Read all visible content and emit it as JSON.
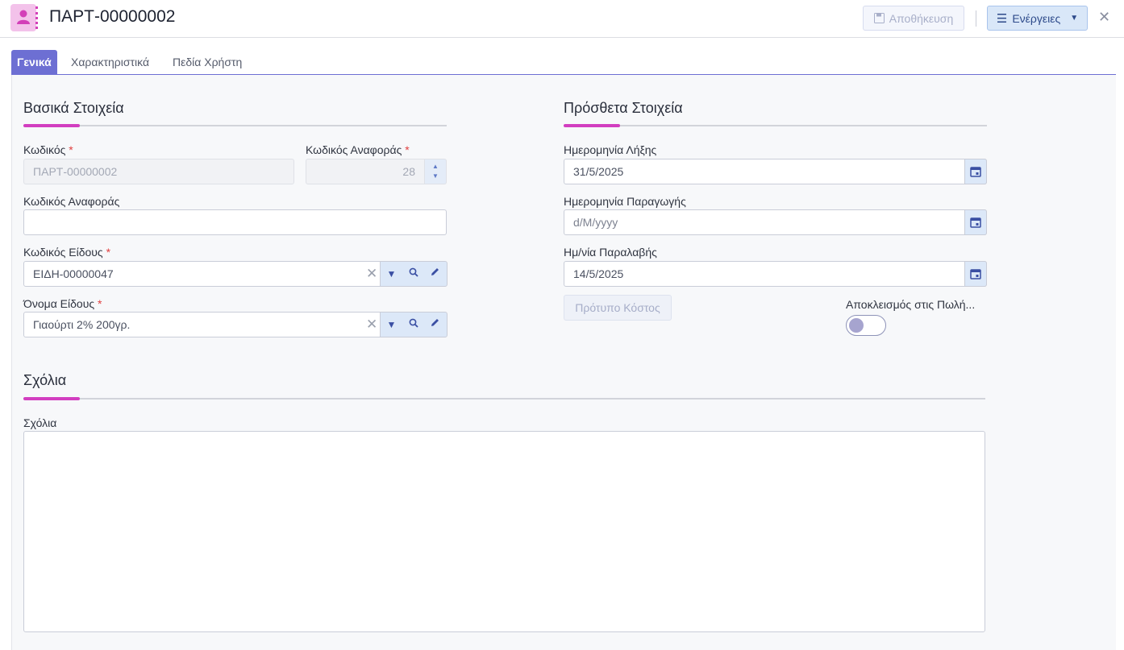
{
  "header": {
    "title": "ΠΑΡΤ-00000002",
    "save_label": "Αποθήκευση",
    "actions_label": "Ενέργειες"
  },
  "tabs": [
    {
      "label": "Γενικά",
      "active": true
    },
    {
      "label": "Χαρακτηριστικά",
      "active": false
    },
    {
      "label": "Πεδία Χρήστη",
      "active": false
    }
  ],
  "basic": {
    "title": "Βασικά Στοιχεία",
    "code_label": "Κωδικός",
    "code_value": "ΠΑΡΤ-00000002",
    "ref_num_label": "Κωδικός Αναφοράς",
    "ref_num_value": "28",
    "ref_code_label": "Κωδικός Αναφοράς",
    "ref_code_value": "",
    "item_code_label": "Κωδικός Είδους",
    "item_code_value": "ΕΙΔΗ-00000047",
    "item_name_label": "Όνομα Είδους",
    "item_name_value": "Γιαούρτι 2% 200γρ."
  },
  "extra": {
    "title": "Πρόσθετα Στοιχεία",
    "expiry_label": "Ημερομηνία Λήξης",
    "expiry_value": "31/5/2025",
    "production_label": "Ημερομηνία Παραγωγής",
    "production_placeholder": "d/M/yyyy",
    "receipt_label": "Ημ/νία Παραλαβής",
    "receipt_value": "14/5/2025",
    "cost_button": "Πρότυπο Κόστος",
    "exclude_label": "Αποκλεισμός στις Πωλή...",
    "exclude_on": false
  },
  "comments": {
    "title": "Σχόλια",
    "field_label": "Σχόλια",
    "value": ""
  },
  "colors": {
    "accent": "#6d6fd3",
    "section_accent": "#d23ec0",
    "required": "#e04040"
  },
  "icons": [
    "person-icon",
    "save-icon",
    "menu-icon",
    "close-icon",
    "chevron-down-icon",
    "search-icon",
    "pencil-icon",
    "calendar-icon",
    "spinner-arrows-icon"
  ]
}
